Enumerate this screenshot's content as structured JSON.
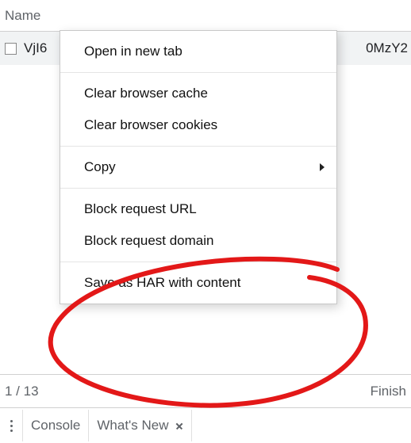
{
  "column_header": "Name",
  "request_row": {
    "name_visible": "VjI6",
    "name_tail": "0MzY2"
  },
  "context_menu": {
    "items": {
      "open_new_tab": "Open in new tab",
      "clear_cache": "Clear browser cache",
      "clear_cookies": "Clear browser cookies",
      "copy": "Copy",
      "block_url": "Block request URL",
      "block_domain": "Block request domain",
      "save_har": "Save as HAR with content"
    }
  },
  "status_bar": {
    "requests": "1 / 13",
    "finish_label": "Finish"
  },
  "drawer_tabs": {
    "console": "Console",
    "whats_new": "What's New"
  },
  "annotation": {
    "stroke": "#e31818"
  }
}
